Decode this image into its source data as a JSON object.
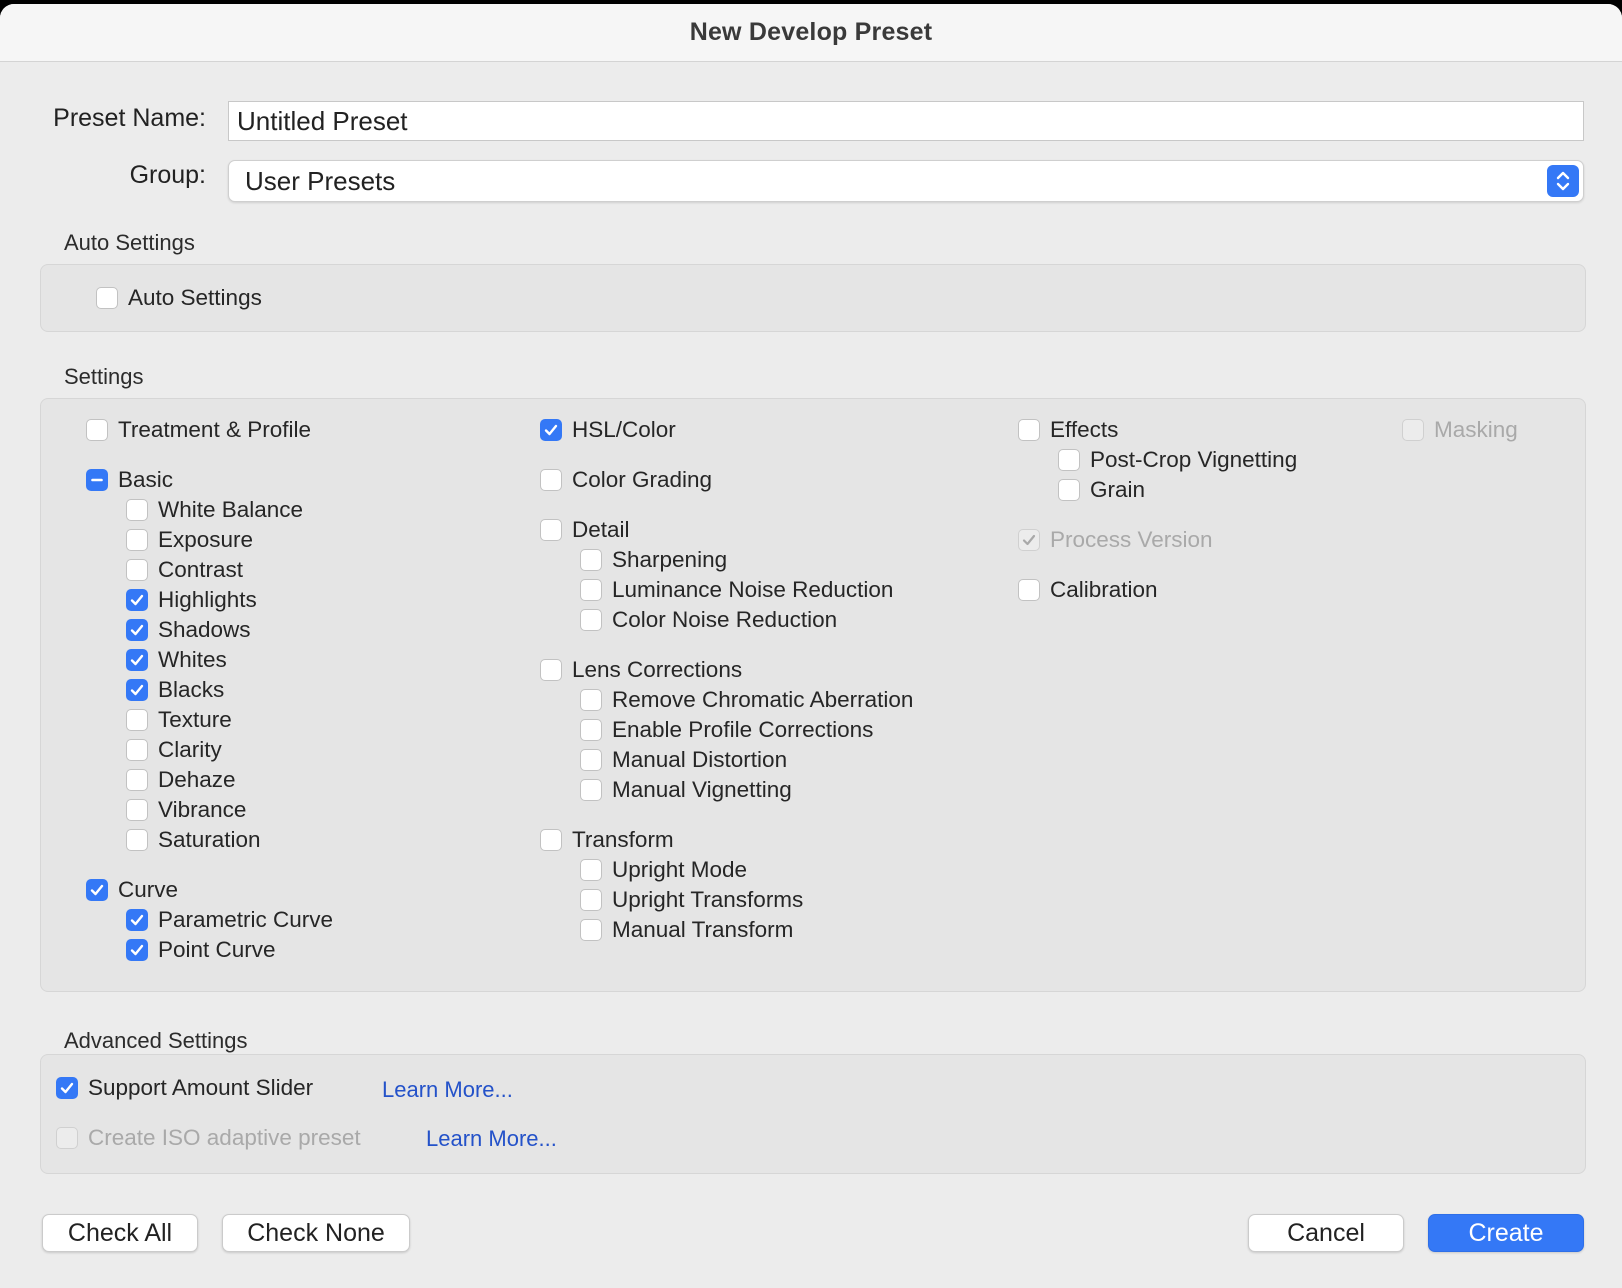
{
  "window": {
    "title": "New Develop Preset"
  },
  "form": {
    "preset_name_label": "Preset Name:",
    "preset_name_value": "Untitled Preset",
    "group_label": "Group:",
    "group_value": "User Presets"
  },
  "auto_settings": {
    "heading": "Auto Settings",
    "checkbox_label": "Auto Settings",
    "checked": false
  },
  "settings": {
    "heading": "Settings",
    "treatment_profile": "Treatment & Profile",
    "basic": "Basic",
    "white_balance": "White Balance",
    "exposure": "Exposure",
    "contrast": "Contrast",
    "highlights": "Highlights",
    "shadows": "Shadows",
    "whites": "Whites",
    "blacks": "Blacks",
    "texture": "Texture",
    "clarity": "Clarity",
    "dehaze": "Dehaze",
    "vibrance": "Vibrance",
    "saturation": "Saturation",
    "curve": "Curve",
    "parametric_curve": "Parametric Curve",
    "point_curve": "Point Curve",
    "hsl_color": "HSL/Color",
    "color_grading": "Color Grading",
    "detail": "Detail",
    "sharpening": "Sharpening",
    "luminance_noise_reduction": "Luminance Noise Reduction",
    "color_noise_reduction": "Color Noise Reduction",
    "lens_corrections": "Lens Corrections",
    "remove_chromatic_aberration": "Remove Chromatic Aberration",
    "enable_profile_corrections": "Enable Profile Corrections",
    "manual_distortion": "Manual Distortion",
    "manual_vignetting": "Manual Vignetting",
    "transform": "Transform",
    "upright_mode": "Upright Mode",
    "upright_transforms": "Upright Transforms",
    "manual_transform": "Manual Transform",
    "effects": "Effects",
    "post_crop_vignetting": "Post-Crop Vignetting",
    "grain": "Grain",
    "process_version": "Process Version",
    "calibration": "Calibration",
    "masking": "Masking"
  },
  "advanced": {
    "heading": "Advanced Settings",
    "support_amount_slider": "Support Amount Slider",
    "learn_more_1": "Learn More...",
    "create_iso_adaptive": "Create ISO adaptive preset",
    "learn_more_2": "Learn More..."
  },
  "buttons": {
    "check_all": "Check All",
    "check_none": "Check None",
    "cancel": "Cancel",
    "create": "Create"
  },
  "colors": {
    "accent": "#3478f6",
    "link": "#2452c9",
    "window_bg": "#ececec"
  }
}
